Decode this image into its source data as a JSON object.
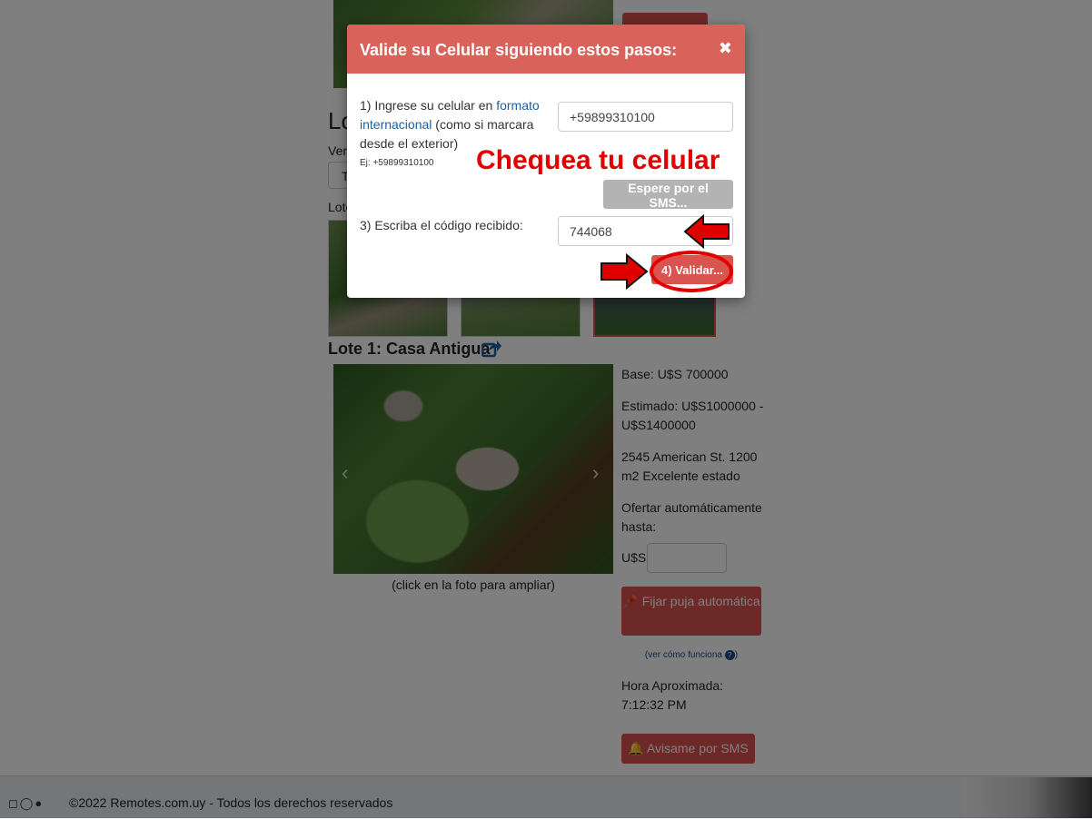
{
  "background": {
    "lot_heading_partial": "Lo",
    "ver_label_partial": "Ver",
    "select_partial": "T",
    "lotes_label_partial": "Lote",
    "lot_title": "Lote 1: Casa Antigua",
    "photo_caption": "(click en la foto para ampliar)",
    "base": "Base: U$S 700000",
    "estimado": "Estimado: U$S1000000 - U$S1400000",
    "description": "2545 American St. 1200 m2 Excelente estado",
    "ofertar_label": "Ofertar automáticamente hasta:",
    "currency_label": "U$S",
    "fijar_button": "Fijar puja automática",
    "ver_como_link": "(ver cómo funciona",
    "hora_label": "Hora Aproximada:",
    "hora_value": "7:12:32 PM",
    "sms_button": "Avisame por SMS"
  },
  "footer": {
    "copyright": "©2022 Remotes.com.uy - Todos los derechos reservados",
    "icons": [
      "instagram-icon",
      "whatsapp-icon",
      "facebook-icon"
    ]
  },
  "modal": {
    "title": "Valide su Celular siguiendo estos pasos:",
    "close_symbol": "✖",
    "step1_prefix": "1) Ingrese su celular en",
    "step1_link": "formato internacional",
    "step1_suffix": "(como si marcara desde el exterior)",
    "example": "Ej: +59899310100",
    "phone_value": "+59899310100",
    "annotation": "Chequea tu celular",
    "espere_button": "Espere por el SMS...",
    "step3_label": "3) Escriba el código recibido:",
    "code_value": "744068",
    "validar_button": "4) Validar..."
  },
  "colors": {
    "accent_red": "#d9534f",
    "modal_header": "#d9625a",
    "annotation_red": "#e00000",
    "link_blue": "#1a5fa0"
  }
}
